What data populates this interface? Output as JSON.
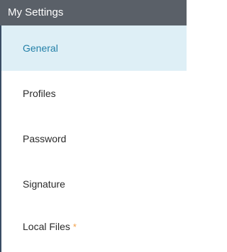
{
  "header": {
    "title": "My Settings"
  },
  "nav": {
    "items": [
      {
        "label": "General",
        "active": true
      },
      {
        "label": "Profiles",
        "active": false
      },
      {
        "label": "Password",
        "active": false
      },
      {
        "label": "Signature",
        "active": false
      },
      {
        "label": "Local Files",
        "active": false,
        "badge": "*"
      }
    ]
  },
  "colors": {
    "header_bg": "#5a6068",
    "active_bg": "#deeff6",
    "active_text": "#2380a8",
    "badge": "#f2a14a",
    "border_left": "#3a4d64"
  },
  "icons": {
    "local_files_badge": "asterisk-icon"
  }
}
